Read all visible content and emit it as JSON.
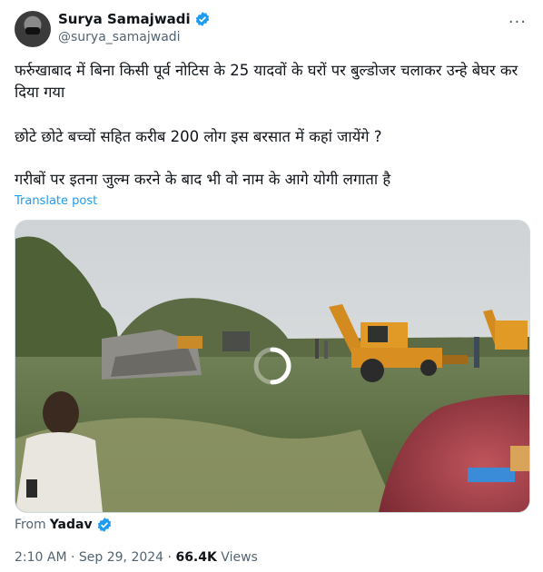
{
  "author": {
    "name": "Surya Samajwadi",
    "handle": "@surya_samajwadi"
  },
  "post": {
    "line1": "फर्रुखाबाद में बिना किसी पूर्व नोटिस के 25 यादवों के घरों पर बुल्डोजर चलाकर उन्हे बेघर कर दिया गया",
    "line2": "छोटे छोटे बच्चों सहित करीब 200 लोग इस बरसात में कहां जायेंगे ?",
    "line3": "गरीबों पर इतना जुल्म करने के बाद भी वो नाम के आगे योगी लगाता है",
    "translate_label": "Translate post"
  },
  "source": {
    "prefix": "From",
    "name": "Yadav"
  },
  "meta": {
    "time": "2:10 AM",
    "sep1": "·",
    "date": "Sep 29, 2024",
    "sep2": "·",
    "views_count": "66.4K",
    "views_label": "Views"
  },
  "colors": {
    "accent": "#1d9bf0",
    "muted": "#536471",
    "text": "#0f1419"
  },
  "icons": {
    "verified": "verified-badge-icon",
    "more": "more-icon",
    "loading": "loading-spinner-icon"
  }
}
